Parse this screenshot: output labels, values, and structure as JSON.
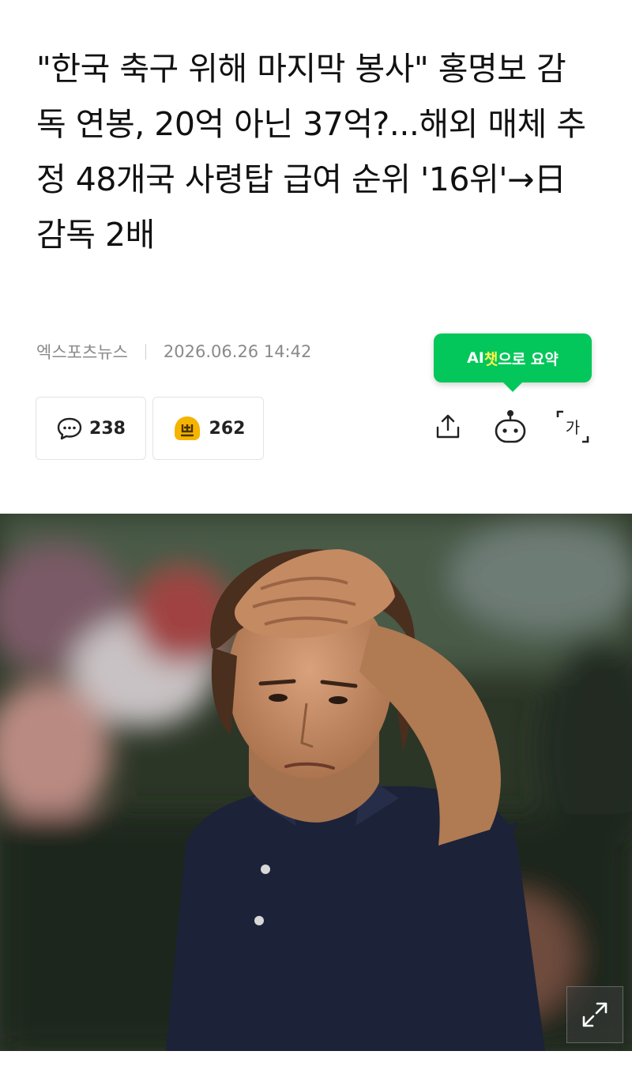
{
  "article": {
    "headline": "\"한국 축구 위해 마지막 봉사\" 홍명보 감독 연봉, 20억 아닌 37억?...해외 매체 추정 48개국 사령탑 급여 순위 '16위'→日 감독 2배",
    "source": "엑스포츠뉴스",
    "datetime": "2026.06.26 14:42"
  },
  "ai_summary": {
    "prefix": "AI",
    "chat": "챗",
    "suffix": "으로 요약"
  },
  "stats": {
    "comments": "238",
    "reactions": "262"
  },
  "tools": [
    "share-icon",
    "bot-icon",
    "font-size-icon"
  ],
  "tool_labels": {
    "font_size": "가"
  },
  "colors": {
    "accent": "#03c75a",
    "accent_text": "#fff34d",
    "reaction_icon": "#f5b400"
  }
}
